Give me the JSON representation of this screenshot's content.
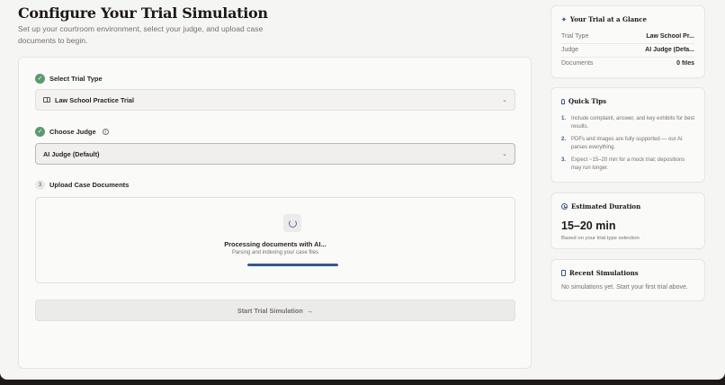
{
  "header": {
    "title": "Configure Your Trial Simulation",
    "subtitle": "Set up your courtroom environment, select your judge, and upload case documents to begin."
  },
  "steps": {
    "trial_type": {
      "label": "Select Trial Type",
      "selected": "Law School Practice Trial",
      "status_icon": "check-icon"
    },
    "judge": {
      "label": "Choose Judge",
      "selected": "AI Judge (Default)",
      "status_icon": "check-icon",
      "info_icon": "info-icon"
    },
    "upload": {
      "number": "3",
      "label": "Upload Case Documents"
    }
  },
  "upload_status": {
    "title": "Processing documents with AI...",
    "subtitle": "Parsing and indexing your case files",
    "progress": 1.0
  },
  "start_button": {
    "label": "Start Trial Simulation",
    "arrow": "→"
  },
  "glance": {
    "title": "Your Trial at a Glance",
    "rows": [
      {
        "key": "Trial Type",
        "value": "Law School Pr..."
      },
      {
        "key": "Judge",
        "value": "AI Judge (Defa..."
      },
      {
        "key": "Documents",
        "value": "0 files"
      }
    ]
  },
  "tips": {
    "title": "Quick Tips",
    "items": [
      {
        "num": "1.",
        "text": "Include complaint, answer, and key exhibits for best results."
      },
      {
        "num": "2.",
        "text": "PDFs and images are fully supported — our AI parses everything."
      },
      {
        "num": "3.",
        "text": "Expect ~15–20 min for a mock trial; depositions may run longer."
      }
    ]
  },
  "duration": {
    "title": "Estimated Duration",
    "value": "15–20 min",
    "note": "Based on your trial type selection"
  },
  "recent": {
    "title": "Recent Simulations",
    "empty": "No simulations yet. Start your first trial above."
  },
  "colors": {
    "accent": "#35579a",
    "success": "#5a9a6e",
    "background": "#f5f5f4"
  }
}
